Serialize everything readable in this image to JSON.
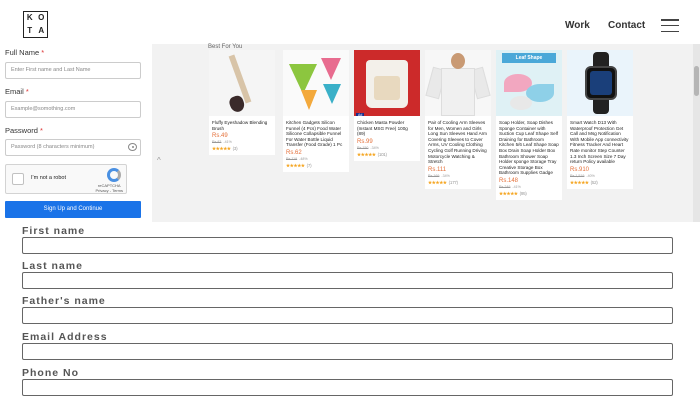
{
  "header": {
    "logo_letters": [
      "K",
      "O",
      "T",
      "A"
    ],
    "nav": {
      "work": "Work",
      "contact": "Contact"
    }
  },
  "signup": {
    "full_name_label": "Full Name",
    "full_name_placeholder": "Enter First name and Last Name",
    "email_label": "Email",
    "email_placeholder": "Example@somothing.com",
    "password_label": "Password",
    "password_placeholder": "Password (8 characters minimum)",
    "required_mark": "*",
    "captcha_text": "I'm not a robot",
    "captcha_brand": "reCAPTCHA",
    "captcha_links": "Privacy - Terms",
    "submit_label": "Sign Up and Continue"
  },
  "carousel": {
    "title": "Best For You",
    "scroll_up_glyph": "^",
    "products": [
      {
        "title": "Fluffy Eyeshadow Blending Brush",
        "price": "Rs.49",
        "old_price": "Rs.83",
        "discount": "-41%",
        "stars": "★★★★★",
        "reviews": "(3)",
        "ad": ""
      },
      {
        "title": "Kitchen Gadgets Silicon Funnel (4 Pcs) Food Water Silicone Collapsible Funnel For Water Bottle Liquid Transfer (Food Grade) 1 Pc",
        "price": "Rs.62",
        "old_price": "Rs.119",
        "discount": "-48%",
        "stars": "★★★★★",
        "reviews": "(7)",
        "ad": ""
      },
      {
        "title": "Chicken Masta Powder (Instant MSG Free) 100g (89)",
        "price": "Rs.99",
        "old_price": "Rs.150",
        "discount": "-34%",
        "stars": "★★★★★",
        "reviews": "(101)",
        "ad": "Ad"
      },
      {
        "title": "Pair of Cooling Arm Sleeves for Men, Women and Girls Long Sun Sleeves Hand Arm Covering Sleeves to Cover Arms, UV Cooling Clothing Cycling Golf Running Driving Motorcycle Watching & Stretch",
        "price": "Rs.111",
        "old_price": "Rs.169",
        "discount": "-34%",
        "stars": "★★★★★",
        "reviews": "(177)",
        "ad": ""
      },
      {
        "title": "Soap Holder, Soap Dishes Sponge Container with Suction Cup Leaf Shape Self Draining for Bathroom Kitchen 5/6 Leaf Shape Soap Box Drain Soap Holder Box Bathroom Shower Soap Holder sponge Storage Tray Creative Storage Box Bathroom Supplies Gadge",
        "price": "Rs.148",
        "old_price": "Rs.249",
        "discount": "-41%",
        "stars": "★★★★★",
        "reviews": "(95)",
        "ad": "",
        "banner": "Leaf Shape"
      },
      {
        "title": "Smart Watch D13 With Waterproof Protection Get Call and Msg Notification With Mobile App connectivity Fitness Tracker And Heart Rate monitor Step Counter 1.3 Inch Screen Size 7 Day return Policy available",
        "price": "Rs.910",
        "old_price": "Rs.1,519",
        "discount": "-40%",
        "stars": "★★★★★",
        "reviews": "(52)",
        "ad": ""
      }
    ]
  },
  "bottom_form": {
    "fields": [
      {
        "label": "First name"
      },
      {
        "label": "Last name"
      },
      {
        "label": "Father's name"
      },
      {
        "label": "Email Address"
      },
      {
        "label": "Phone No"
      }
    ]
  },
  "colors": {
    "accent": "#1a73e8",
    "price": "#e4703a",
    "star": "#f5a623",
    "carousel_bg": "#f2f2f2"
  },
  "icons": {
    "menu": "hamburger-icon",
    "password_toggle": "eye-icon",
    "captcha": "recaptcha-icon"
  }
}
